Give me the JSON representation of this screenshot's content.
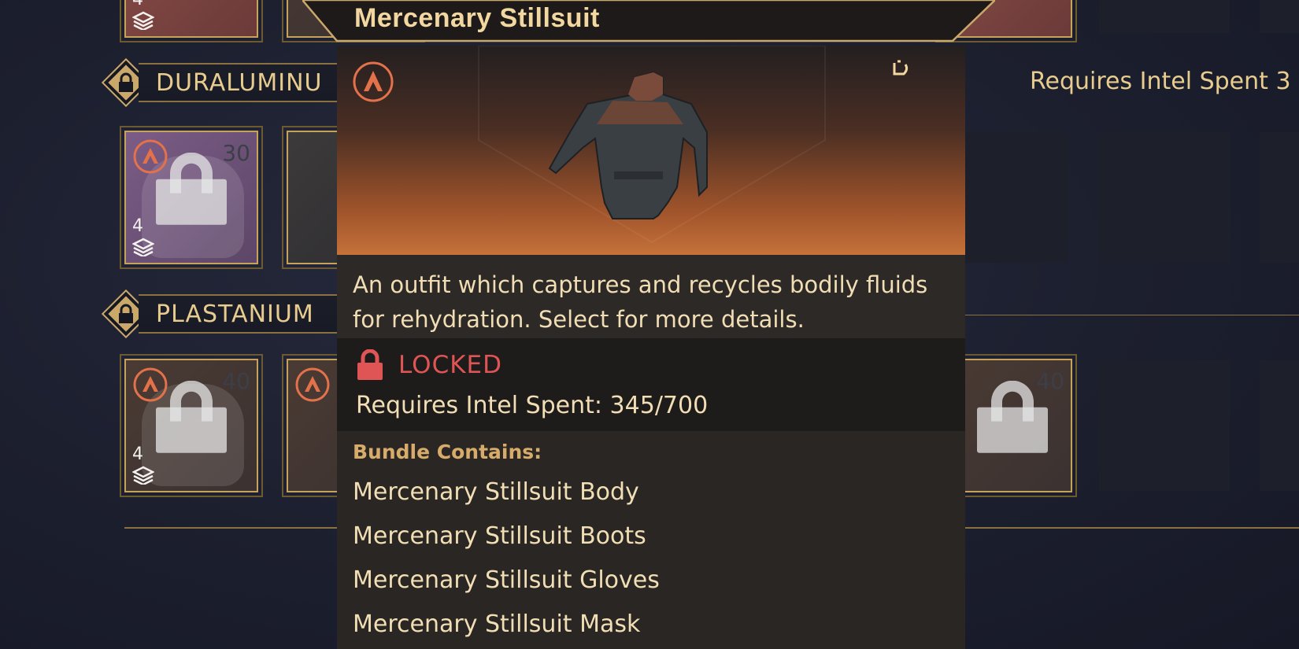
{
  "tiers": [
    {
      "name": "DURALUMINU",
      "lock_icon": "lock-icon"
    },
    {
      "name": "PLASTANIUM",
      "lock_icon": "lock-icon"
    }
  ],
  "slots": {
    "top_row_count": "4",
    "duraluminum_slot": {
      "level": "30",
      "stack": "4"
    },
    "plastanium_slot_1": {
      "level": "40",
      "stack": "4"
    },
    "plastanium_slot_right": {
      "level": "40"
    }
  },
  "right_requirement": "Requires Intel Spent 3",
  "tooltip": {
    "title": "Mercenary Stillsuit",
    "faction_icon": "faction-emblem-icon",
    "corner_icon": "customize-icon",
    "description": "An outfit which captures and recycles bodily fluids for rehydration. Select for more details.",
    "status": "LOCKED",
    "requirement": "Requires Intel Spent: 345/700",
    "bundle_title": "Bundle Contains:",
    "bundle_items": [
      "Mercenary Stillsuit Body",
      "Mercenary Stillsuit Boots",
      "Mercenary Stillsuit Gloves",
      "Mercenary Stillsuit Mask"
    ]
  },
  "colors": {
    "accent_gold": "#c9a86a",
    "locked_red": "#df5555",
    "text_cream": "#f1deb5"
  }
}
